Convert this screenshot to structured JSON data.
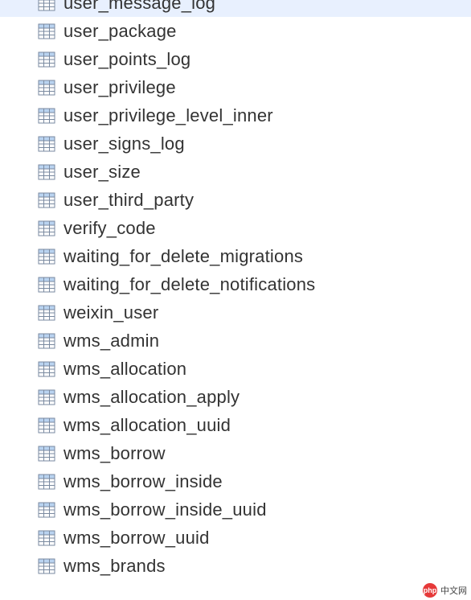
{
  "tables": [
    {
      "name": "user_message_log"
    },
    {
      "name": "user_package"
    },
    {
      "name": "user_points_log"
    },
    {
      "name": "user_privilege"
    },
    {
      "name": "user_privilege_level_inner"
    },
    {
      "name": "user_signs_log"
    },
    {
      "name": "user_size"
    },
    {
      "name": "user_third_party"
    },
    {
      "name": "verify_code"
    },
    {
      "name": "waiting_for_delete_migrations"
    },
    {
      "name": "waiting_for_delete_notifications"
    },
    {
      "name": "weixin_user"
    },
    {
      "name": "wms_admin"
    },
    {
      "name": "wms_allocation"
    },
    {
      "name": "wms_allocation_apply"
    },
    {
      "name": "wms_allocation_uuid"
    },
    {
      "name": "wms_borrow"
    },
    {
      "name": "wms_borrow_inside"
    },
    {
      "name": "wms_borrow_inside_uuid"
    },
    {
      "name": "wms_borrow_uuid"
    },
    {
      "name": "wms_brands"
    }
  ],
  "watermark": {
    "badge": "php",
    "text": "中文网"
  }
}
